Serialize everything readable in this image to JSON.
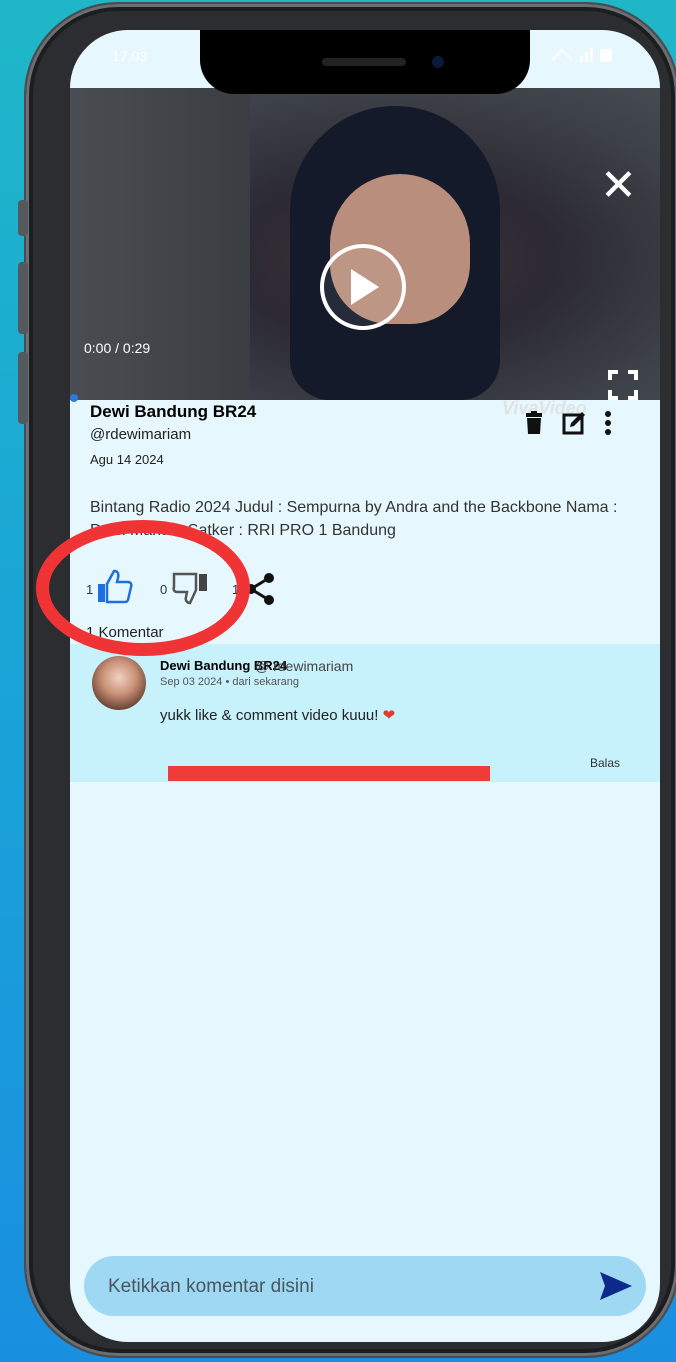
{
  "status_bar": {
    "time": "17.03"
  },
  "video": {
    "time": "0:00 / 0:29",
    "watermark": "VivaVideo"
  },
  "post": {
    "author_name": "Dewi Bandung BR24",
    "author_handle": "@rdewimariam",
    "date": "Agu 14 2024",
    "description": "Bintang Radio 2024 Judul : Sempurna by Andra and the Backbone Nama : Dewi Mariam Satker : RRI PRO 1 Bandung",
    "likes": "1",
    "dislikes": "0",
    "shares": "1",
    "comment_count": "1 Komentar"
  },
  "comment": {
    "name": "Dewi Bandung BR24",
    "handle": "@ rdewimariam",
    "date": "Sep 03 2024  •  dari sekarang",
    "text": "yukk like & comment video kuuu! ",
    "reply_label": "Balas"
  },
  "composer": {
    "placeholder": "Ketikkan komentar disini"
  },
  "colors": {
    "accent": "#2a7be0",
    "highlight": "#f03436",
    "panel": "#c7f1fb"
  }
}
